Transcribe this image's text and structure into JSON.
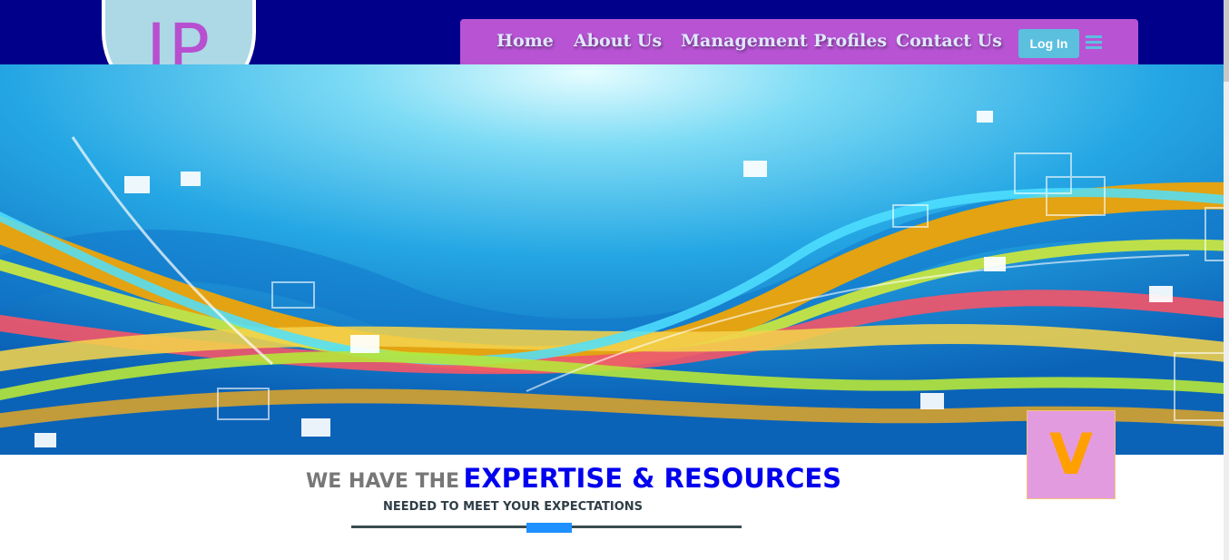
{
  "logo": {
    "text": "IP"
  },
  "nav": {
    "items": [
      {
        "label": "Home"
      },
      {
        "label": "About Us"
      },
      {
        "label": "Management Profiles"
      },
      {
        "label": "Contact Us"
      }
    ],
    "login_label": "Log In",
    "menu_icon": "hamburger-menu-icon"
  },
  "hero": {
    "image": "colorful-abstract-waves-banner"
  },
  "badge": {
    "text": "V"
  },
  "tagline": {
    "lead": "WE HAVE THE",
    "highlight": "EXPERTISE & RESOURCES",
    "subtitle": "NEEDED TO MEET YOUR EXPECTATIONS"
  },
  "colors": {
    "header_bg": "#00008b",
    "nav_bg": "#b854d4",
    "login_bg": "#5bc0de",
    "logo_bg": "#add8e6",
    "logo_text": "#b84fd0",
    "highlight_text": "#0000ee",
    "accent": "#1e90ff",
    "badge_bg": "#e39be0",
    "badge_text": "#ff9f00"
  }
}
